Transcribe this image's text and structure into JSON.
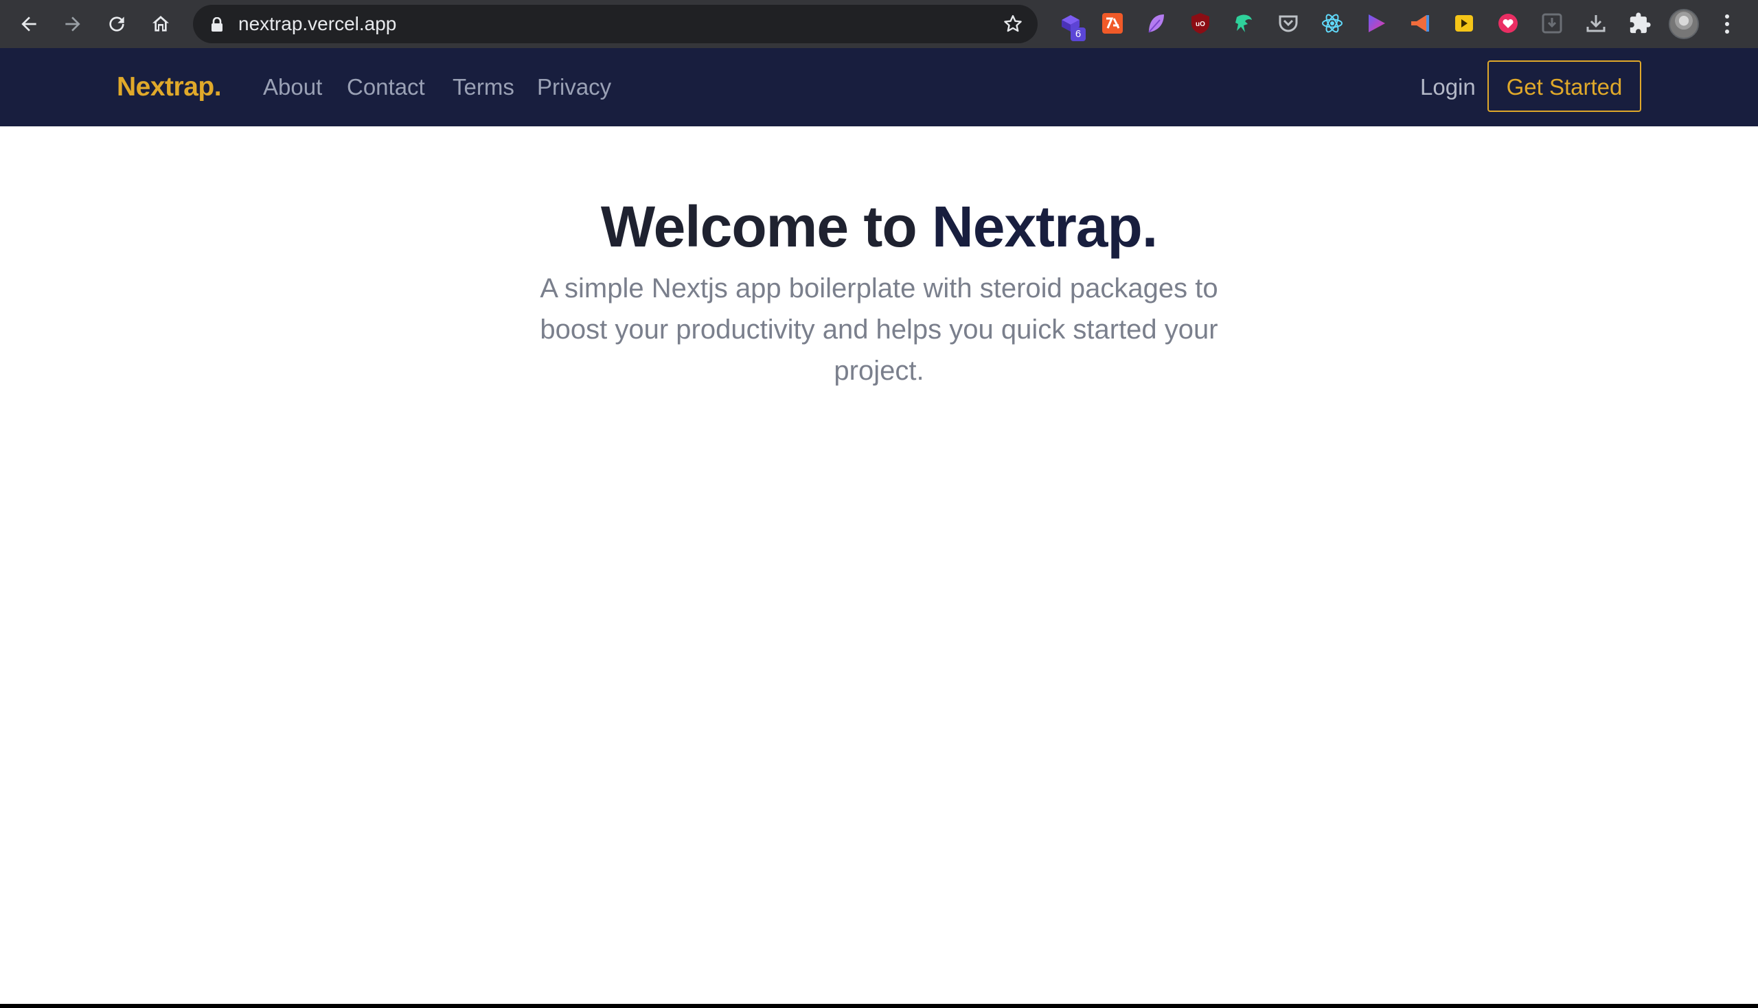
{
  "browser": {
    "url": "nextrap.vercel.app",
    "extension_badge": "6",
    "icons": [
      "back-icon",
      "forward-icon",
      "reload-icon",
      "home-icon",
      "lock-icon",
      "star-icon",
      "puzzle-icon",
      "download-icon",
      "menu-icon"
    ]
  },
  "header": {
    "brand": "Nextrap.",
    "nav": [
      {
        "label": "About"
      },
      {
        "label": "Contact"
      },
      {
        "label": "Terms"
      },
      {
        "label": "Privacy"
      }
    ],
    "login_label": "Login",
    "cta_label": "Get Started"
  },
  "hero": {
    "title_prefix": "Welcome to ",
    "title_brand": "Nextrap.",
    "subtitle": "A simple Nextjs app boilerplate with steroid packages to boost your productivity and helps you quick started your project."
  },
  "colors": {
    "header_bg": "#181e3e",
    "brand_accent": "#e0a92a",
    "chrome_bg": "#35363a",
    "omnibox_bg": "#202124"
  }
}
